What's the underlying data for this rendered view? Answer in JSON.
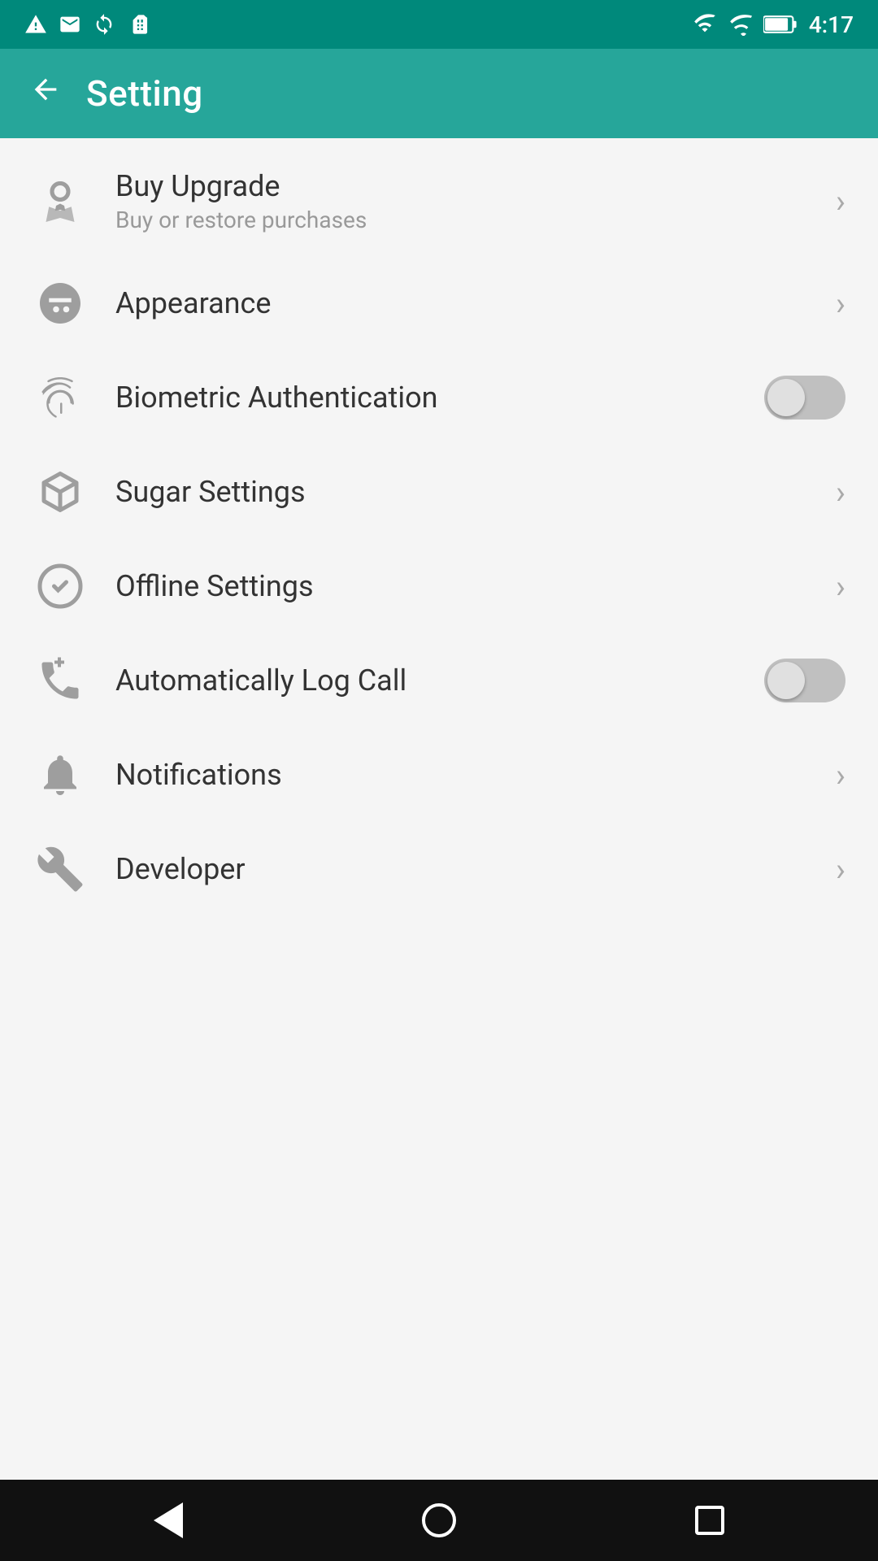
{
  "statusBar": {
    "time": "4:17",
    "icons": [
      "alert-icon",
      "gmail-icon",
      "sync-icon",
      "sim-icon"
    ]
  },
  "appBar": {
    "title": "Setting",
    "backLabel": "←"
  },
  "settings": {
    "items": [
      {
        "id": "buy-upgrade",
        "title": "Buy Upgrade",
        "subtitle": "Buy or restore purchases",
        "actionType": "chevron",
        "iconType": "award"
      },
      {
        "id": "appearance",
        "title": "Appearance",
        "subtitle": "",
        "actionType": "chevron",
        "iconType": "face"
      },
      {
        "id": "biometric-auth",
        "title": "Biometric Authentication",
        "subtitle": "",
        "actionType": "toggle",
        "toggleState": false,
        "iconType": "fingerprint"
      },
      {
        "id": "sugar-settings",
        "title": "Sugar Settings",
        "subtitle": "",
        "actionType": "chevron",
        "iconType": "cube"
      },
      {
        "id": "offline-settings",
        "title": "Offline Settings",
        "subtitle": "",
        "actionType": "chevron",
        "iconType": "offline"
      },
      {
        "id": "auto-log-call",
        "title": "Automatically Log Call",
        "subtitle": "",
        "actionType": "toggle",
        "toggleState": false,
        "iconType": "phone"
      },
      {
        "id": "notifications",
        "title": "Notifications",
        "subtitle": "",
        "actionType": "chevron",
        "iconType": "bell"
      },
      {
        "id": "developer",
        "title": "Developer",
        "subtitle": "",
        "actionType": "chevron",
        "iconType": "wrench"
      }
    ]
  },
  "navBar": {
    "back": "back",
    "home": "home",
    "recents": "recents"
  }
}
